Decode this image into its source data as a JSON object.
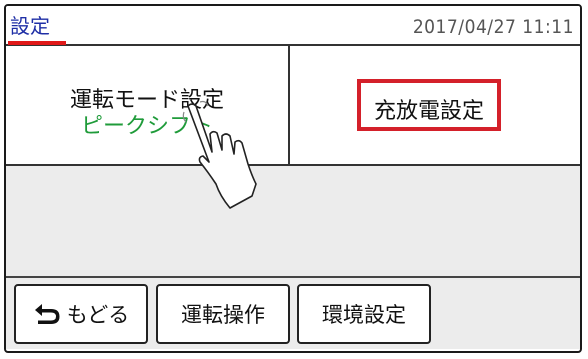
{
  "header": {
    "title": "設定",
    "datetime": "2017/04/27 11:11"
  },
  "tiles": {
    "mode": {
      "label": "運転モード設定",
      "value": "ピークシフト"
    },
    "charge": {
      "label": "充放電設定"
    }
  },
  "bottom_nav": {
    "back_label": "もどる",
    "ops_label": "運転操作",
    "env_label": "環境設定"
  },
  "colors": {
    "title_blue": "#1f2fa6",
    "underline_red": "#e01818",
    "mode_green": "#1f9b3a",
    "highlight_red": "#d4202a"
  },
  "icons": {
    "back": "return-arrow-icon",
    "hand": "pointing-hand-icon"
  }
}
